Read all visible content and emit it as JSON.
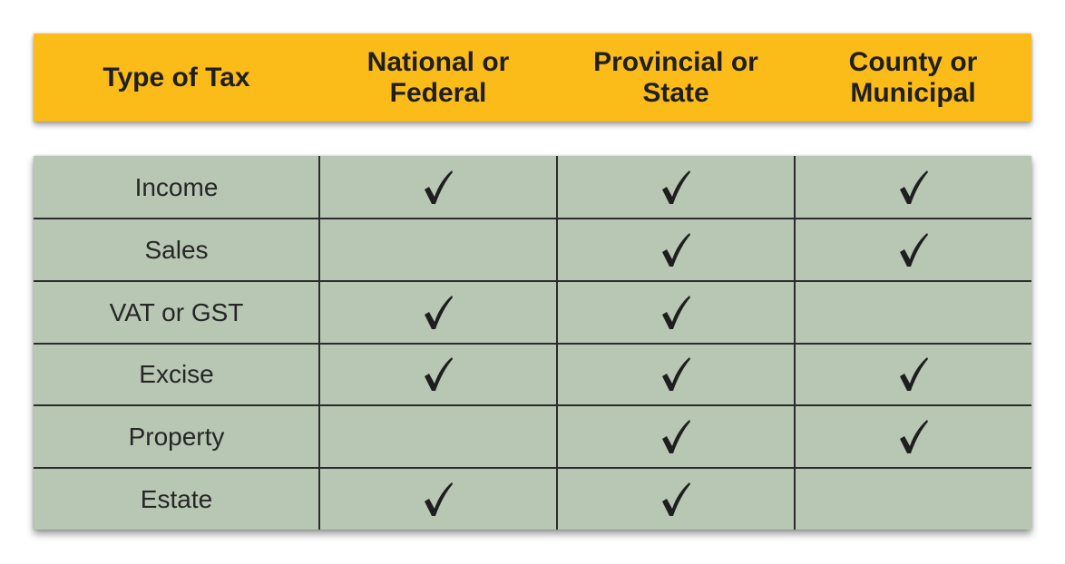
{
  "header": {
    "col0": "Type of Tax",
    "col1": "National or\nFederal",
    "col2": "Provincial or\nState",
    "col3": "County or\nMunicipal"
  },
  "check_icon": "check-mark",
  "rows": [
    {
      "label": "Income",
      "national": true,
      "provincial": true,
      "county": true
    },
    {
      "label": "Sales",
      "national": false,
      "provincial": true,
      "county": true
    },
    {
      "label": "VAT or GST",
      "national": true,
      "provincial": true,
      "county": false
    },
    {
      "label": "Excise",
      "national": true,
      "provincial": true,
      "county": true
    },
    {
      "label": "Property",
      "national": false,
      "provincial": true,
      "county": true
    },
    {
      "label": "Estate",
      "national": true,
      "provincial": true,
      "county": false
    }
  ],
  "colors": {
    "header_bg": "#fbbb18",
    "table_bg": "#b7c7b3",
    "grid": "#2b2b2b"
  }
}
